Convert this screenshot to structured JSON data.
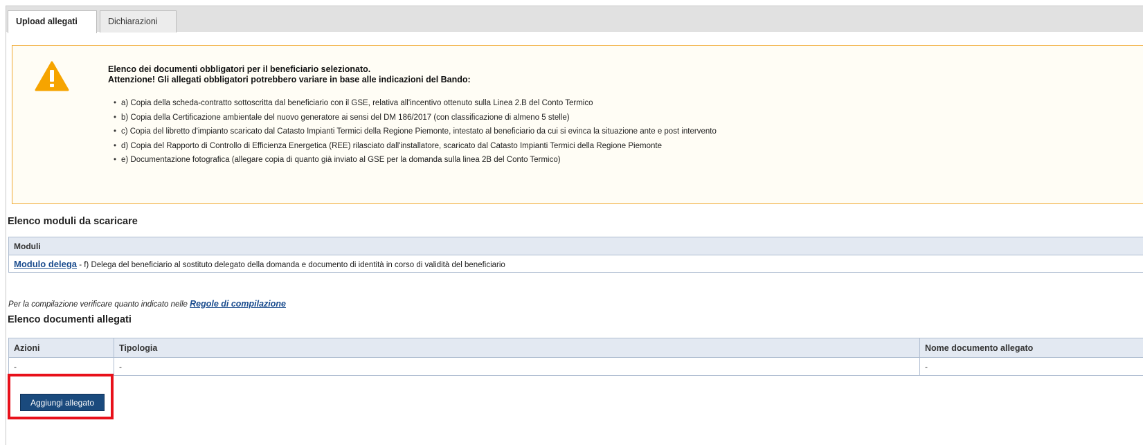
{
  "tabs": [
    {
      "label": "Upload allegati",
      "active": true
    },
    {
      "label": "Dichiarazioni",
      "active": false
    }
  ],
  "warning": {
    "icon": "warning-triangle-icon",
    "title_line1": "Elenco dei documenti obbligatori per il beneficiario selezionato.",
    "title_line2": "Attenzione! Gli allegati obbligatori potrebbero variare in base alle indicazioni del Bando:",
    "items": [
      "a) Copia della scheda-contratto sottoscritta dal beneficiario con il GSE, relativa all'incentivo ottenuto sulla Linea 2.B del Conto Termico",
      "b) Copia della Certificazione ambientale del nuovo generatore ai sensi del DM 186/2017 (con classificazione di almeno 5 stelle)",
      "c) Copia del libretto d'impianto scaricato dal Catasto Impianti Termici della Regione Piemonte, intestato al beneficiario da cui si evinca la situazione ante e post intervento",
      "d) Copia del Rapporto di Controllo di Efficienza Energetica (REE) rilasciato dall'installatore, scaricato dal Catasto Impianti Termici della Regione Piemonte",
      "e) Documentazione fotografica (allegare copia di quanto già inviato al GSE per la domanda sulla linea 2B del Conto Termico)"
    ],
    "border_color": "#f0a830"
  },
  "moduli_section": {
    "title": "Elenco moduli da scaricare",
    "header": "Moduli",
    "row_link": "Modulo delega",
    "row_text": " - f) Delega del beneficiario al sostituto delegato della domanda e documento di identità in corso di validità del beneficiario"
  },
  "hint": {
    "text": "Per la compilazione verificare quanto indicato nelle ",
    "link": "Regole di compilazione"
  },
  "allegati_section": {
    "title": "Elenco documenti allegati",
    "columns": [
      "Azioni",
      "Tipologia",
      "Nome documento allegato"
    ],
    "rows": [
      [
        "-",
        "-",
        "-"
      ]
    ]
  },
  "add_button": {
    "label": "Aggiungi allegato",
    "color": "#1a4a7d"
  },
  "highlight_color": "#e8101a"
}
